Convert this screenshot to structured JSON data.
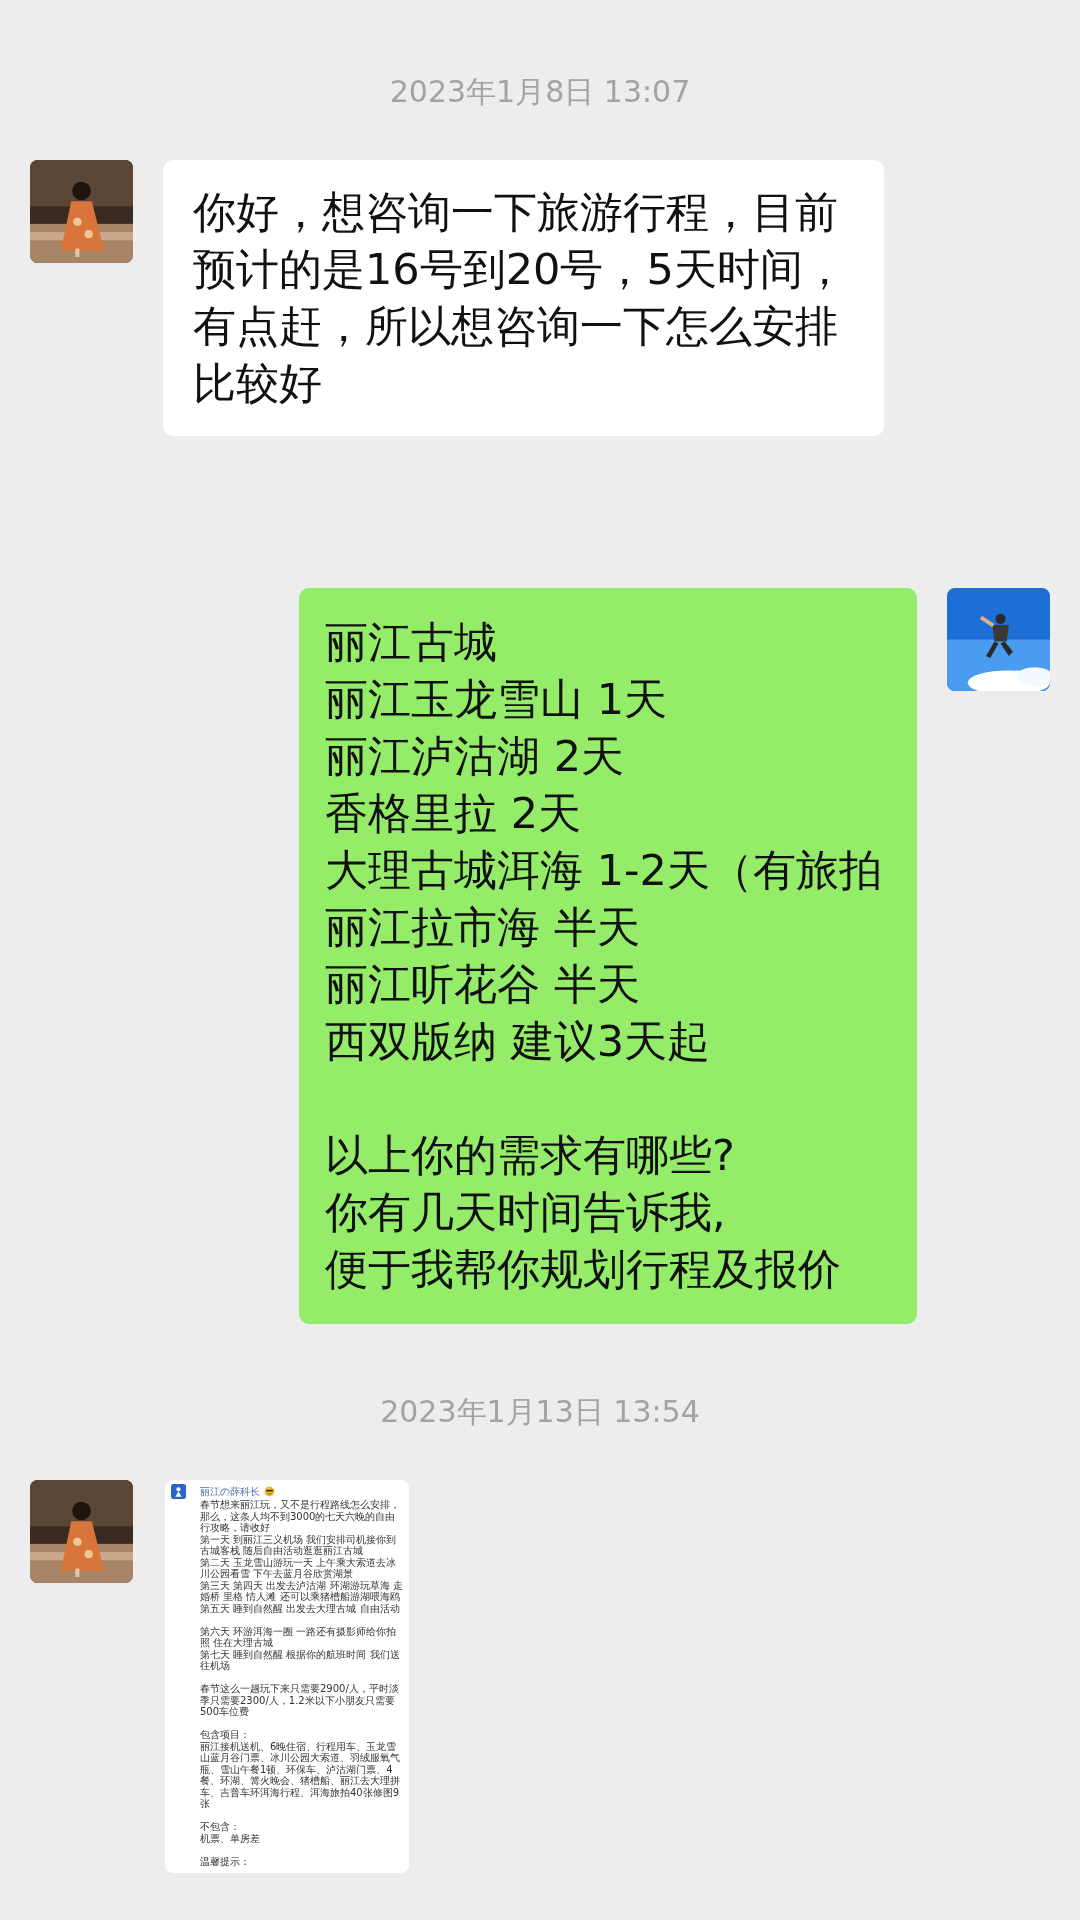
{
  "messages": [
    {
      "kind": "time",
      "text": "2023年1月8日 13:07"
    },
    {
      "kind": "text",
      "outgoing": false,
      "lines": [
        "你好，想咨询一下旅游行程，目前预计的是16号到20号，5天时间，有点赶，所以想咨询一下怎么安排比较好"
      ]
    },
    {
      "kind": "text",
      "outgoing": true,
      "lines": [
        "丽江古城",
        "丽江玉龙雪山 1天",
        "丽江泸沽湖 2天",
        "香格里拉 2天",
        "大理古城洱海 1-2天（有旅拍",
        "丽江拉市海 半天",
        "丽江听花谷 半天",
        "西双版纳 建议3天起"
      ],
      "lines_after_gap": [
        "以上你的需求有哪些?",
        "你有几天时间告诉我,",
        "便于我帮你规划行程及报价"
      ]
    },
    {
      "kind": "time",
      "text": "2023年1月13日 13:54"
    },
    {
      "outgoing": false,
      "sender": "丽江の薛科长",
      "blocks": [
        [
          "春节想来丽江玩，又不是行程路线怎么安排，那么，这条人均不到3000的七天六晚的自由行攻略，请收好",
          "第一天 到丽江三义机场 我们安排司机接你到古城客栈 随后自由活动逛逛丽江古城",
          "第二天 玉龙雪山游玩一天 上午乘大索道去冰川公园看雪 下午去蓝月谷欣赏湖景",
          "第三天 第四天 出发去泸沽湖 环湖游玩草海 走婚桥 里格 情人滩 还可以乘猪槽船游湖喂海鸥",
          "第五天 睡到自然醒 出发去大理古城 自由活动"
        ],
        [
          "第六天 环游洱海一圈 一路还有摄影师给你拍照 住在大理古城",
          "第七天 睡到自然醒 根据你的航班时间 我们送往机场"
        ],
        [
          "春节这么一趟玩下来只需要2900/人，平时淡季只需要2300/人，1.2米以下小朋友只需要500车位费"
        ],
        [
          "包含项目：",
          "丽江接机送机、6晚住宿、行程用车、玉龙雪山蓝月谷门票、冰川公园大索道、羽绒服氧气瓶、雪山午餐1顿、环保车、泸沽湖门票、4餐、环湖、篝火晚会、猪槽船、丽江去大理拼车、吉普车环洱海行程、洱海旅拍40张修图9张"
        ],
        [
          "不包含：",
          "机票、单房差"
        ],
        [
          "温馨提示："
        ]
      ]
    }
  ]
}
